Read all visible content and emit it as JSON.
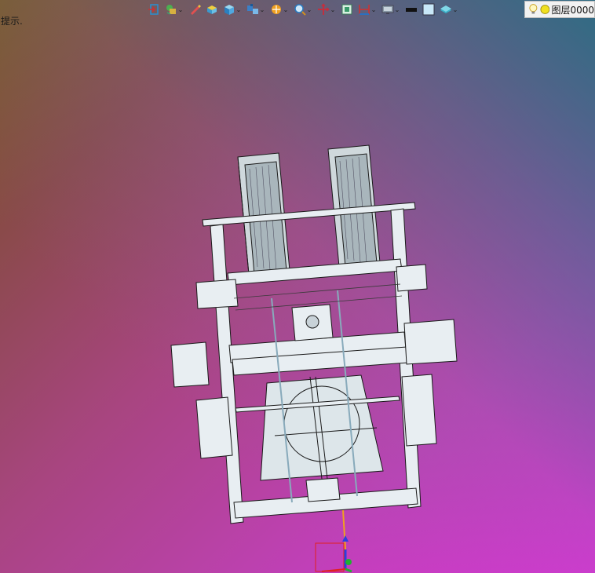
{
  "hint": "提示.",
  "toolbar": {
    "items": [
      {
        "icon": "exit-sketch-icon",
        "dropdown": false
      },
      {
        "icon": "render-style-icon",
        "dropdown": true
      },
      {
        "icon": "pencil-icon",
        "dropdown": false
      },
      {
        "icon": "box-primitive-icon",
        "dropdown": false
      },
      {
        "icon": "view-cube-icon",
        "dropdown": true
      },
      {
        "icon": "standard-views-icon",
        "dropdown": true
      },
      {
        "icon": "section-view-icon",
        "dropdown": true
      },
      {
        "icon": "zoom-icon",
        "dropdown": true
      },
      {
        "icon": "pan-icon",
        "dropdown": true
      },
      {
        "icon": "fit-view-icon",
        "dropdown": false
      },
      {
        "icon": "dimension-icon",
        "dropdown": true
      },
      {
        "icon": "display-settings-icon",
        "dropdown": true
      },
      {
        "icon": "color-black-icon",
        "dropdown": false
      },
      {
        "icon": "color-lightblue-icon",
        "dropdown": false
      },
      {
        "icon": "layer-fill-icon",
        "dropdown": true
      }
    ]
  },
  "layer": {
    "label": "图层0000",
    "icons": [
      "lightbulb-icon",
      "layer-color-icon"
    ]
  },
  "colors": {
    "accent_cyan": "#3bc4d8",
    "model_line": "#1a1a1a",
    "model_fill": "#e8eef2"
  }
}
